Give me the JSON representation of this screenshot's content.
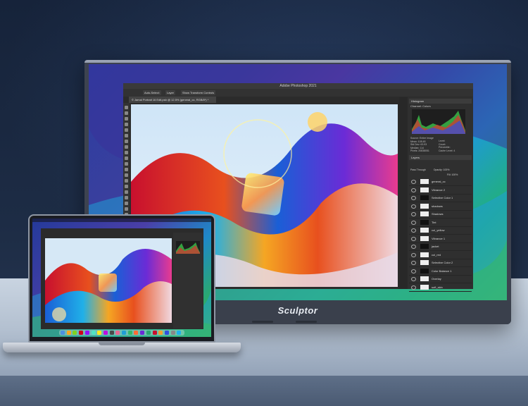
{
  "monitor": {
    "brand": "Sculptor"
  },
  "photoshop": {
    "app_title": "Adobe Photoshop 2021",
    "options": [
      "Auto-Select:",
      "Layer",
      "Show Transform Controls"
    ],
    "doc_tab": "© Jamal Portrait 16 Edit.psb @ 12.5% (general_cc, RGB/8*) *",
    "panels": {
      "histogram": "Histogram",
      "channel_label": "Channel:",
      "channel_value": "Colors",
      "source_label": "Source:",
      "source_value": "Entire Image",
      "stats": [
        "Mean: 108.48",
        "Std Dev: 63.93",
        "Median: 114",
        "Pixels: 20838051"
      ],
      "stats_right": [
        "Level:",
        "Count:",
        "Percentile:",
        "Cache Level: 4"
      ],
      "layers": "Layers",
      "blend_mode": "Pass Through",
      "opacity": "Opacity: 100%",
      "fill": "Fill: 100%"
    },
    "layers": [
      "general_cc",
      "Vibrance 2",
      "Selective Color 1",
      "shadows",
      "Shadows",
      "Tint",
      "col_yellow",
      "Vibrance 1",
      "jacket",
      "col_red",
      "Selective Color 2",
      "Color Balance 1",
      "Overlay",
      "soft_skin"
    ]
  },
  "colors": {
    "monitor_frame": "#3d4350",
    "ps_bg": "#2b2b2b",
    "ribbon": [
      "#c8102e",
      "#e8501e",
      "#f5a623",
      "#1a5fd6",
      "#6b2bd6",
      "#e83b8f",
      "#20b0e8"
    ]
  }
}
